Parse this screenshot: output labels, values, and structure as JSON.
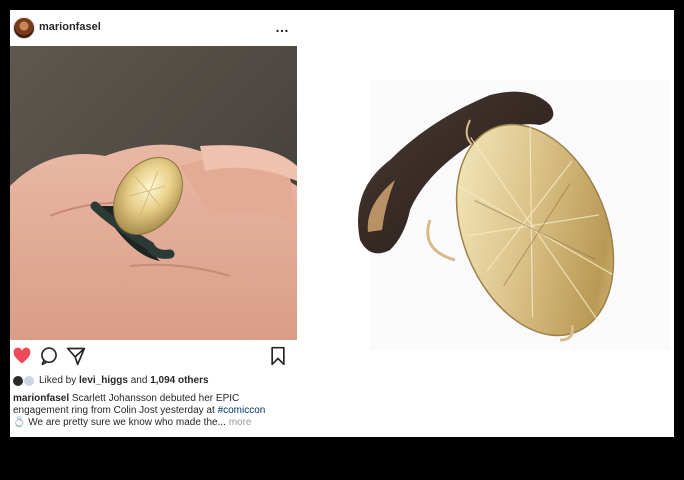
{
  "post": {
    "username": "marionfasel",
    "more_icon": "…",
    "icons": {
      "like": "heart-icon",
      "comment": "comment-icon",
      "share": "paper-plane-icon",
      "save": "bookmark-icon",
      "more": "more-icon"
    },
    "likes": {
      "prefix": "Liked by",
      "user": "levi_higgs",
      "conj": "and",
      "count": "1,094 others"
    },
    "caption": {
      "username": "marionfasel",
      "text1": "Scarlett Johansson debuted her EPIC engagement ring from Colin Jost yesterday at",
      "hashtag": "#comiccon",
      "emoji": "💍",
      "text2": "We are pretty sure we know who made the...",
      "more": "more"
    }
  },
  "colors": {
    "heart": "#ed4956",
    "text": "#262626",
    "hashtag": "#003569",
    "muted": "#999999",
    "background": "#000000"
  }
}
